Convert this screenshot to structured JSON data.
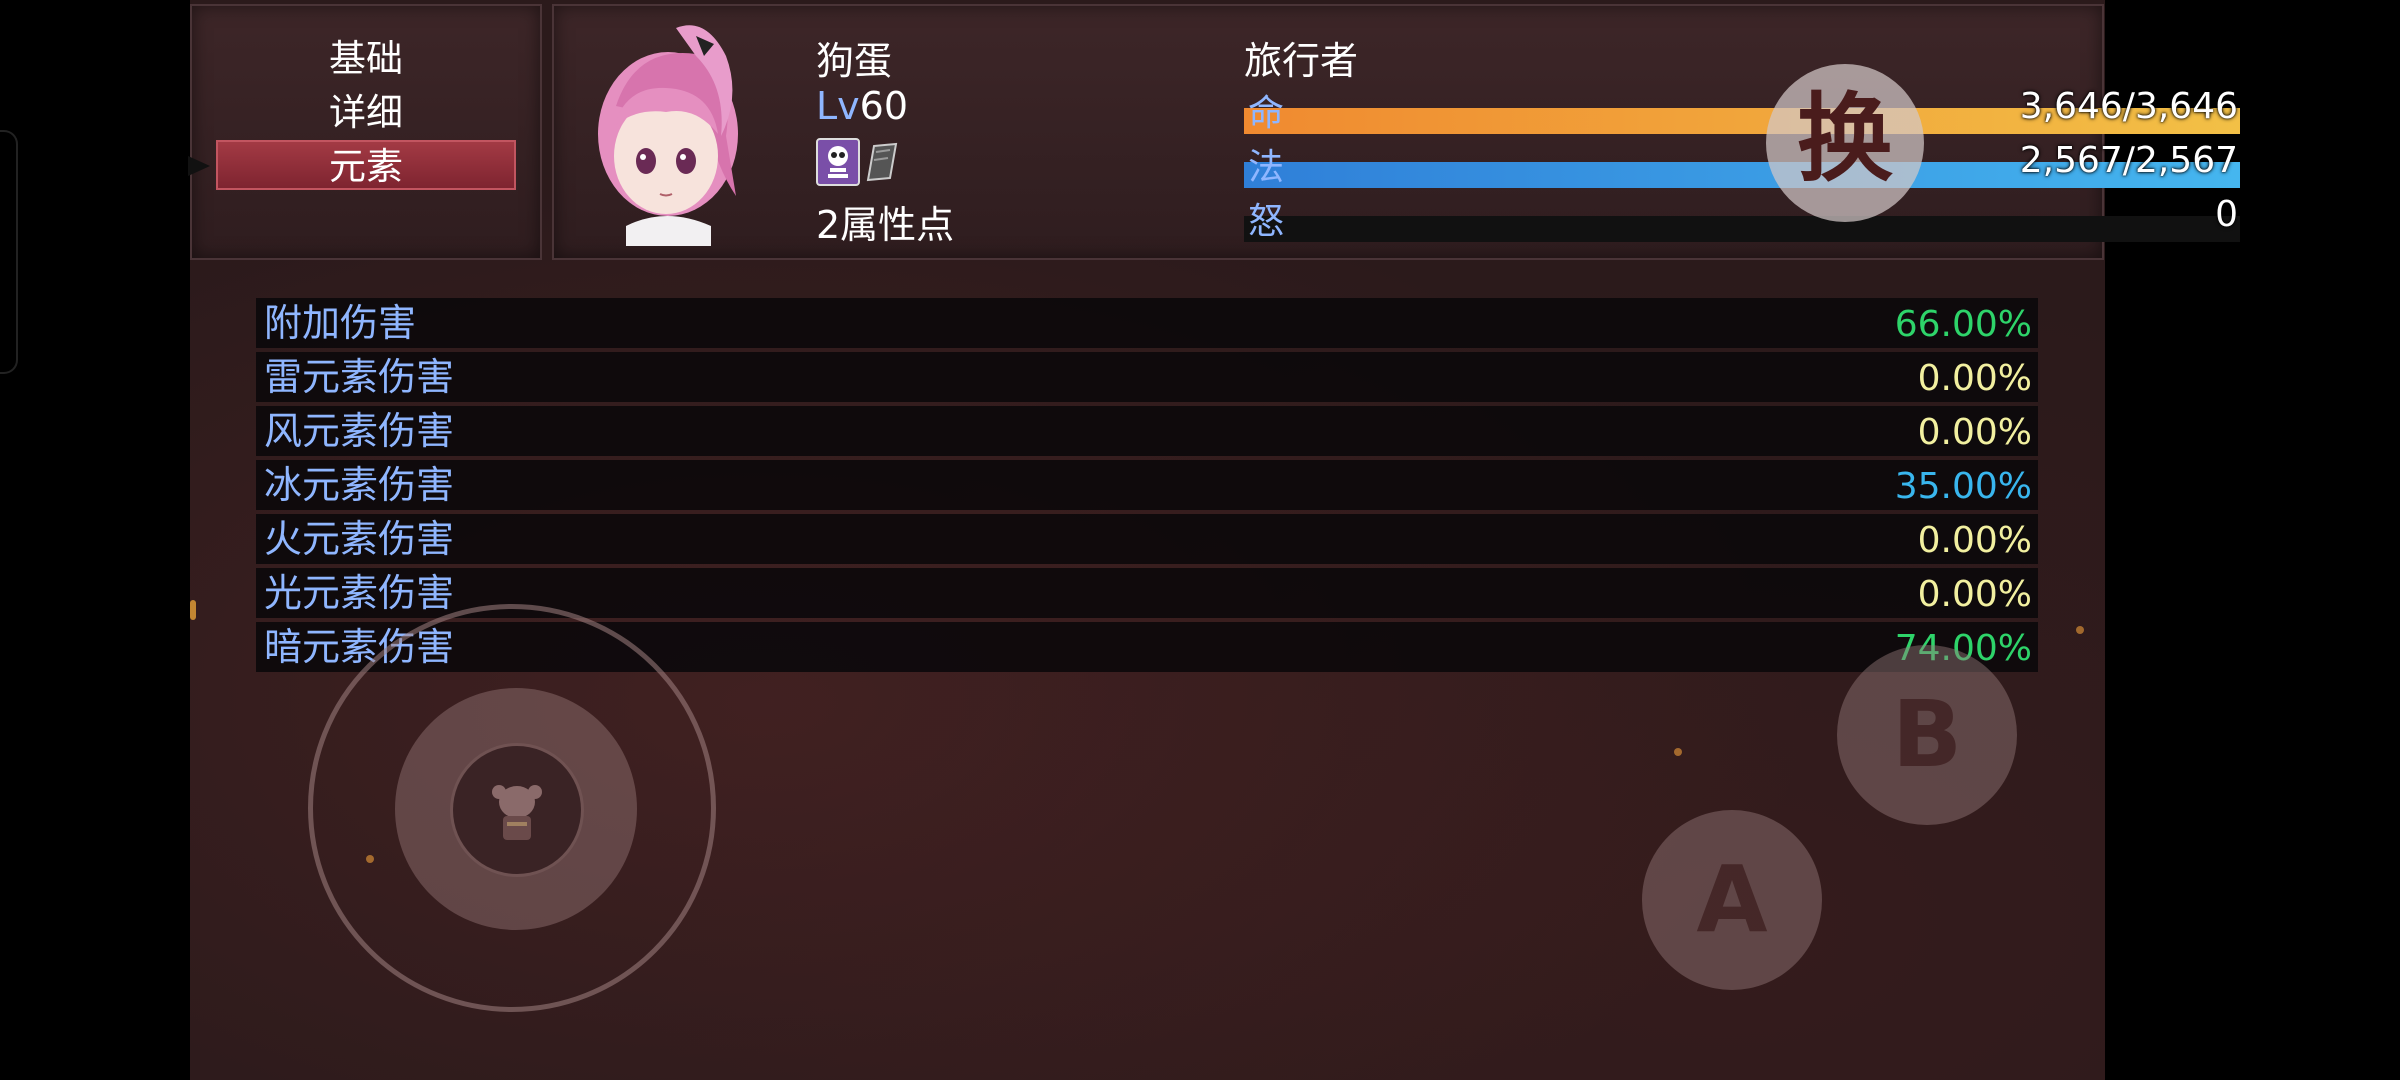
{
  "menu": {
    "items": [
      {
        "label": "基础",
        "selected": false
      },
      {
        "label": "详细",
        "selected": false
      },
      {
        "label": "元素",
        "selected": true
      }
    ]
  },
  "status": {
    "name": "狗蛋",
    "class": "旅行者",
    "level_prefix": "Lv",
    "level": "60",
    "attribute_points": "2属性点",
    "hp": {
      "label": "命",
      "value": "3,646/3,646",
      "ratio": 1.0,
      "color_start": "#f08a30",
      "color_end": "#f2c046"
    },
    "mp": {
      "label": "法",
      "value": "2,567/2,567",
      "ratio": 1.0,
      "color_start": "#2f7fd8",
      "color_end": "#45b6ef"
    },
    "rage": {
      "label": "怒",
      "value": "0",
      "ratio": 0.0,
      "color_start": "#c03030",
      "color_end": "#e06040"
    },
    "state_icons": [
      "skull-icon",
      "book-icon"
    ]
  },
  "attributes": [
    {
      "name": "附加伤害",
      "value": "66.00%",
      "color": "#2ed46a"
    },
    {
      "name": "雷元素伤害",
      "value": "0.00%",
      "color": "#f2f0a0"
    },
    {
      "name": "风元素伤害",
      "value": "0.00%",
      "color": "#f2f0a0"
    },
    {
      "name": "冰元素伤害",
      "value": "35.00%",
      "color": "#39b6ee"
    },
    {
      "name": "火元素伤害",
      "value": "0.00%",
      "color": "#f2f0a0"
    },
    {
      "name": "光元素伤害",
      "value": "0.00%",
      "color": "#f2f0a0"
    },
    {
      "name": "暗元素伤害",
      "value": "74.00%",
      "color": "#2ed46a"
    }
  ],
  "controls": {
    "swap_label": "换",
    "b_label": "B",
    "a_label": "A"
  }
}
